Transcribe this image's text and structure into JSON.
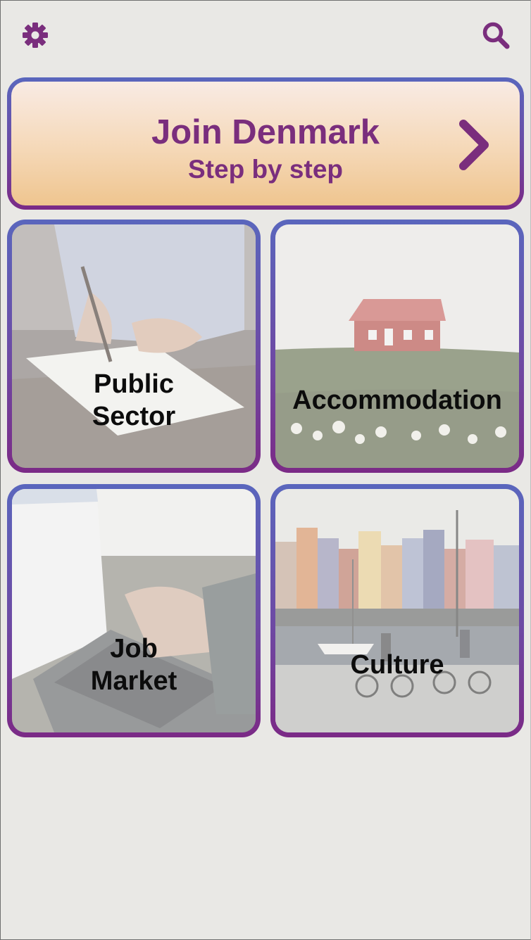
{
  "hero": {
    "title": "Join Denmark",
    "subtitle": "Step by step"
  },
  "tiles": [
    {
      "label_line1": "Public",
      "label_line2": "Sector"
    },
    {
      "label": "Accommodation"
    },
    {
      "label_line1": "Job",
      "label_line2": "Market"
    },
    {
      "label": "Culture"
    }
  ],
  "colors": {
    "accent": "#7a2e7d",
    "border_top": "#5a66bd",
    "hero_gradient_bottom": "#efc58f"
  },
  "icons": {
    "top_left": "gear-icon",
    "top_right": "search-icon",
    "hero_arrow": "chevron-right-icon"
  }
}
